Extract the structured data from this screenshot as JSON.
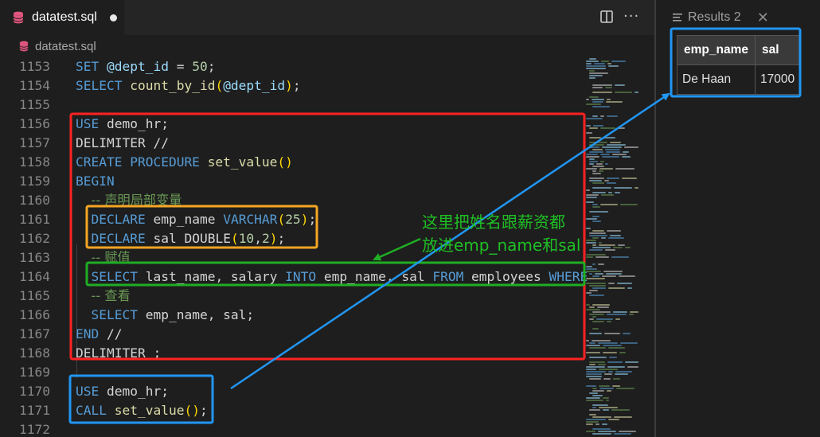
{
  "editor": {
    "tab": {
      "title": "datatest.sql"
    },
    "breadcrumb": "datatest.sql",
    "lines": [
      {
        "num": "1153",
        "tokens": [
          [
            "kw",
            "SET"
          ],
          [
            "txt",
            " "
          ],
          [
            "var",
            "@dept_id"
          ],
          [
            "txt",
            " = "
          ],
          [
            "num",
            "50"
          ],
          [
            "txt",
            ";"
          ]
        ]
      },
      {
        "num": "1154",
        "tokens": [
          [
            "kw",
            "SELECT"
          ],
          [
            "txt",
            " "
          ],
          [
            "fn",
            "count_by_id"
          ],
          [
            "br",
            "("
          ],
          [
            "var",
            "@dept_id"
          ],
          [
            "br",
            ")"
          ],
          [
            "txt",
            ";"
          ]
        ]
      },
      {
        "num": "1155",
        "tokens": []
      },
      {
        "num": "1156",
        "tokens": [
          [
            "kw",
            "USE"
          ],
          [
            "txt",
            " demo_hr;"
          ]
        ]
      },
      {
        "num": "1157",
        "tokens": [
          [
            "txt",
            "DELIMITER //"
          ]
        ]
      },
      {
        "num": "1158",
        "tokens": [
          [
            "kw",
            "CREATE PROCEDURE"
          ],
          [
            "txt",
            " "
          ],
          [
            "fn",
            "set_value"
          ],
          [
            "br",
            "()"
          ]
        ]
      },
      {
        "num": "1159",
        "tokens": [
          [
            "kw",
            "BEGIN"
          ]
        ]
      },
      {
        "num": "1160",
        "tokens": [
          [
            "txt",
            "  "
          ],
          [
            "cm",
            "-- 声明局部变量"
          ]
        ]
      },
      {
        "num": "1161",
        "tokens": [
          [
            "txt",
            "  "
          ],
          [
            "kw",
            "DECLARE"
          ],
          [
            "txt",
            " emp_name "
          ],
          [
            "kw",
            "VARCHAR"
          ],
          [
            "br",
            "("
          ],
          [
            "num",
            "25"
          ],
          [
            "br",
            ")"
          ],
          [
            "txt",
            ";"
          ]
        ]
      },
      {
        "num": "1162",
        "tokens": [
          [
            "txt",
            "  "
          ],
          [
            "kw",
            "DECLARE"
          ],
          [
            "txt",
            " sal DOUBLE"
          ],
          [
            "br",
            "("
          ],
          [
            "num",
            "10"
          ],
          [
            "txt",
            ","
          ],
          [
            "num",
            "2"
          ],
          [
            "br",
            ")"
          ],
          [
            "txt",
            ";"
          ]
        ]
      },
      {
        "num": "1163",
        "tokens": [
          [
            "txt",
            "  "
          ],
          [
            "cm",
            "-- 赋值"
          ]
        ]
      },
      {
        "num": "1164",
        "tokens": [
          [
            "txt",
            "  "
          ],
          [
            "kw",
            "SELECT"
          ],
          [
            "txt",
            " last_name, salary "
          ],
          [
            "kw",
            "INTO"
          ],
          [
            "txt",
            " emp_name, sal "
          ],
          [
            "kw",
            "FROM"
          ],
          [
            "txt",
            " employees "
          ],
          [
            "kw",
            "WHERE"
          ]
        ]
      },
      {
        "num": "1165",
        "tokens": [
          [
            "txt",
            "  "
          ],
          [
            "cm",
            "-- 查看"
          ]
        ]
      },
      {
        "num": "1166",
        "tokens": [
          [
            "txt",
            "  "
          ],
          [
            "kw",
            "SELECT"
          ],
          [
            "txt",
            " emp_name, sal;"
          ]
        ]
      },
      {
        "num": "1167",
        "tokens": [
          [
            "kw",
            "END"
          ],
          [
            "txt",
            " //"
          ]
        ]
      },
      {
        "num": "1168",
        "tokens": [
          [
            "txt",
            "DELIMITER ;"
          ]
        ]
      },
      {
        "num": "1169",
        "tokens": []
      },
      {
        "num": "1170",
        "tokens": [
          [
            "kw",
            "USE"
          ],
          [
            "txt",
            " demo_hr;"
          ]
        ]
      },
      {
        "num": "1171",
        "tokens": [
          [
            "kw",
            "CALL"
          ],
          [
            "txt",
            " "
          ],
          [
            "fn",
            "set_value"
          ],
          [
            "br",
            "()"
          ],
          [
            "txt",
            ";"
          ]
        ]
      },
      {
        "num": "1172",
        "tokens": []
      }
    ]
  },
  "results": {
    "tab_title": "Results 2",
    "columns": [
      "emp_name",
      "sal"
    ],
    "rows": [
      [
        "De Haan",
        "17000"
      ]
    ]
  },
  "annotation": {
    "note_line1": "这里把姓名跟薪资都",
    "note_line2": "放进emp_name和sal"
  },
  "colors": {
    "red_box": "#ff2222",
    "orange_box": "#f5a623",
    "green_box": "#1fae24",
    "blue_box": "#2196f3",
    "note_text": "#1fbf24"
  }
}
